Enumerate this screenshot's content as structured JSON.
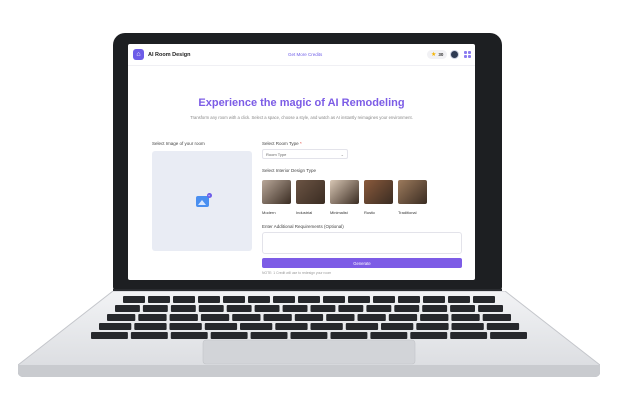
{
  "header": {
    "logo_glyph": "⌂",
    "app_title": "AI Room Design",
    "credits_link": "Get More Credits",
    "credit_count": "30",
    "star_glyph": "★"
  },
  "hero": {
    "title": "Experience the magic of AI Remodeling",
    "subtitle": "Transform any room with a click. Select a space, choose a style, and watch as AI instantly reimagines your environment."
  },
  "upload": {
    "label": "Select Image of your room",
    "icon": "image-add-icon",
    "plus_glyph": "+"
  },
  "room_type": {
    "label": "Select Room Type",
    "required_mark": "*",
    "selected": "Room Type",
    "chevron": "⌄"
  },
  "design_type": {
    "label": "Select Interior Design Type",
    "options": [
      {
        "name": "Modern",
        "color": "#b9a89a"
      },
      {
        "name": "Industrial",
        "color": "#6b5444"
      },
      {
        "name": "Minimalist",
        "color": "#d8c6b4"
      },
      {
        "name": "Rustic",
        "color": "#8a5a3c"
      },
      {
        "name": "Traditional",
        "color": "#9c7a5c"
      }
    ]
  },
  "requirements": {
    "label": "Enter Additional Requirements (Optional)",
    "placeholder": ""
  },
  "generate": {
    "label": "Generate",
    "hint": "NOTE: 1 Credit will use to redesign your room"
  },
  "colors": {
    "accent": "#7d5ce6",
    "bezel": "#1d1f22"
  }
}
